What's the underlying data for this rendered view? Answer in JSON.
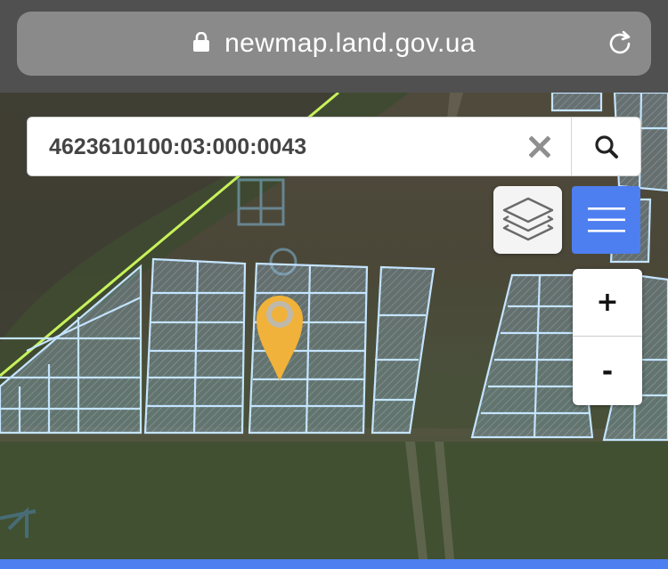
{
  "browser": {
    "url": "newmap.land.gov.ua",
    "lock_icon": "lock-icon",
    "reload_icon": "reload-icon"
  },
  "search": {
    "value": "4623610100:03:000:0043",
    "clear_icon": "close-icon",
    "submit_icon": "search-icon"
  },
  "controls": {
    "layers_icon": "layers-icon",
    "menu_icon": "hamburger-menu-icon",
    "zoom_in_label": "+",
    "zoom_out_label": "-"
  },
  "map": {
    "marker_icon": "map-pin-icon",
    "marker_color": "#f0b23a",
    "parcel_outline_color": "#bfe3ff",
    "boundary_line_color": "#c7f25a"
  },
  "colors": {
    "accent": "#4e7ff0",
    "chrome_bg": "#505050",
    "urlbar_bg": "#8a8a8a"
  }
}
